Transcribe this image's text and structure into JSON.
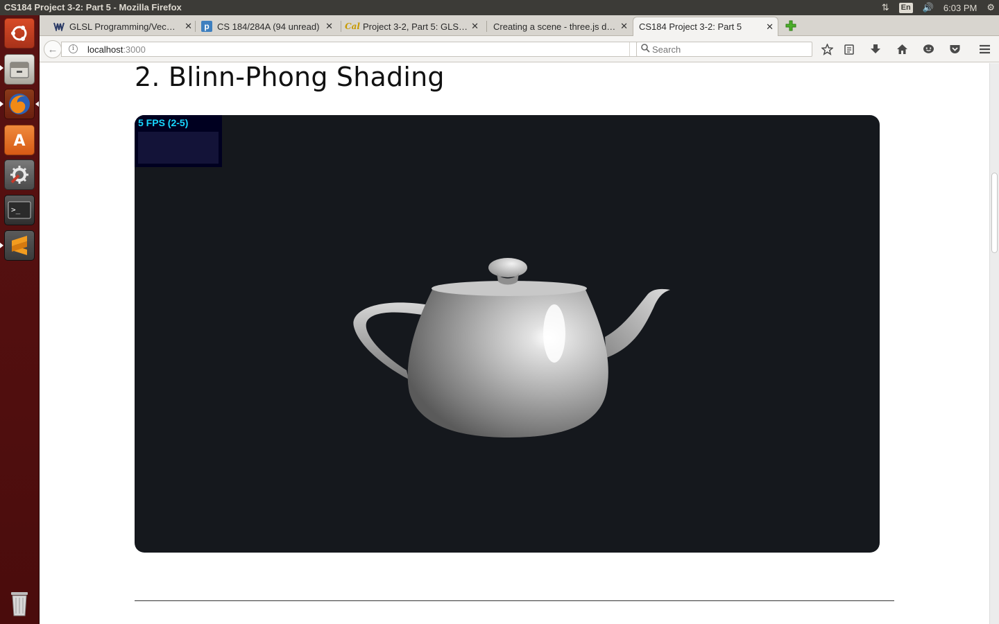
{
  "window": {
    "title": "CS184 Project 3-2: Part 5 - Mozilla Firefox"
  },
  "tray": {
    "keyboard": "En",
    "clock": "6:03 PM"
  },
  "tabs": [
    {
      "label": "GLSL Programming/Vec…",
      "icon": "wikibooks-icon"
    },
    {
      "label": "CS 184/284A (94 unread)",
      "icon": "piazza-icon"
    },
    {
      "label": "Project 3-2, Part 5: GLS…",
      "icon": "berkeley-cal-icon"
    },
    {
      "label": "Creating a scene - three.js d…",
      "icon": ""
    },
    {
      "label": "CS184 Project 3-2: Part 5",
      "icon": "",
      "active": true
    }
  ],
  "nav": {
    "url_host": "localhost",
    "url_port": ":3000",
    "search_placeholder": "Search"
  },
  "page": {
    "heading": "2. Blinn-Phong Shading",
    "stats_fps": "5 FPS (2-5)"
  },
  "colors": {
    "launcher": "#4f0f0f",
    "canvas_bg": "#15181d",
    "fps_text": "#19d9ff",
    "stats_bg": "#000020"
  }
}
